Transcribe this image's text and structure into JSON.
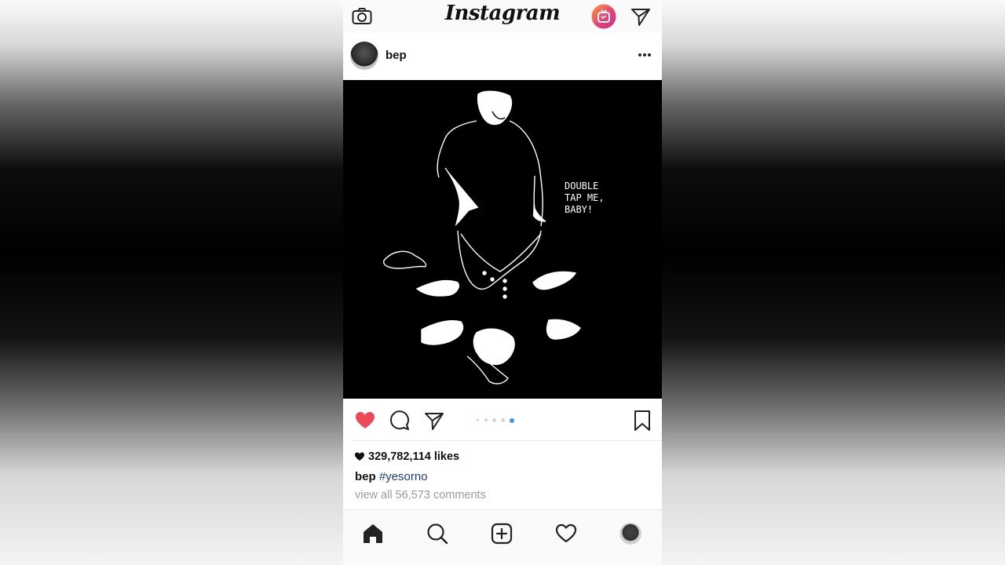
{
  "app": {
    "logo_text": "Instagram"
  },
  "topbar": {
    "icons": [
      "camera-icon",
      "igtv-icon",
      "direct-message-icon"
    ],
    "igtv_gradient": [
      "#f58529",
      "#dd2a7b"
    ]
  },
  "post": {
    "username": "bep",
    "image_text": "DOUBLE\nTAP ME,\nBABY!",
    "carousel": {
      "count": 5,
      "active_index": 4,
      "active_color": "#3897f0"
    },
    "likes": "329,782,114 likes",
    "caption": {
      "username": "bep",
      "hashtag": "#yesorno"
    },
    "comments_link": "view all 56,573 comments",
    "liked": true,
    "like_color": "#ed4956"
  },
  "bottomnav": {
    "items": [
      "home-icon",
      "search-icon",
      "add-post-icon",
      "activity-heart-icon",
      "profile-avatar"
    ]
  }
}
